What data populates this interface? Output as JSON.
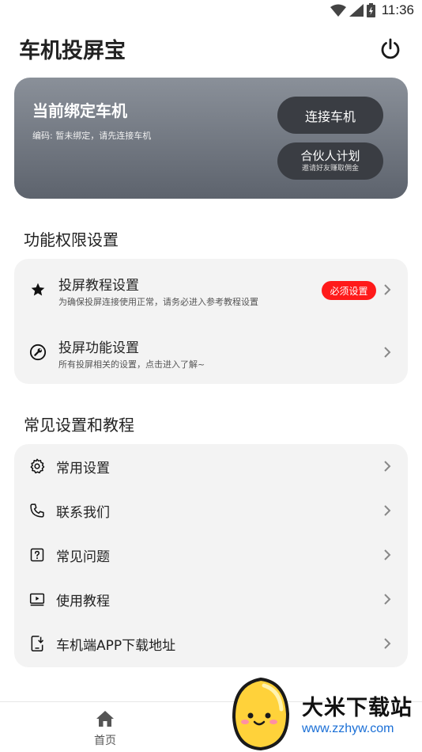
{
  "status_bar": {
    "time": "11:36"
  },
  "app": {
    "title": "车机投屏宝"
  },
  "hero": {
    "title": "当前绑定车机",
    "subtitle": "编码: 暂未绑定，请先连接车机",
    "connect_label": "连接车机",
    "partner_label": "合伙人计划",
    "partner_sub": "邀请好友赚取佣金"
  },
  "permissions": {
    "title": "功能权限设置",
    "items": [
      {
        "icon": "star-icon",
        "label": "投屏教程设置",
        "desc": "为确保投屏连接使用正常，请务必进入参考教程设置",
        "badge": "必须设置"
      },
      {
        "icon": "wrench-icon",
        "label": "投屏功能设置",
        "desc": "所有投屏相关的设置，点击进入了解~"
      }
    ]
  },
  "common": {
    "title": "常见设置和教程",
    "items": [
      {
        "icon": "gear-icon",
        "label": "常用设置"
      },
      {
        "icon": "phone-icon",
        "label": "联系我们"
      },
      {
        "icon": "question-icon",
        "label": "常见问题"
      },
      {
        "icon": "video-icon",
        "label": "使用教程"
      },
      {
        "icon": "download-icon",
        "label": "车机端APP下载地址"
      }
    ]
  },
  "bottom_nav": {
    "home_label": "首页"
  },
  "watermark": {
    "text": "大米下载站",
    "url": "www.zzhyw.com"
  },
  "colors": {
    "badge": "#ff1a1a",
    "hero_button": "#3a3d43",
    "card_bg": "#f3f3f3"
  }
}
